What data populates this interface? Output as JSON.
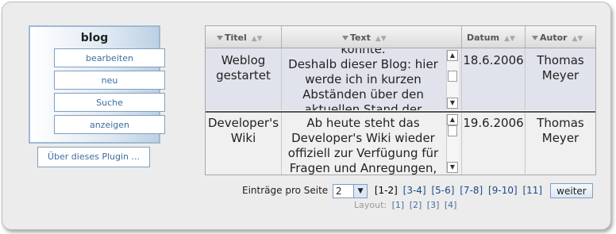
{
  "menu": {
    "title": "blog",
    "items": [
      "bearbeiten",
      "neu",
      "Suche",
      "anzeigen"
    ],
    "plugin_label": "Über dieses Plugin ..."
  },
  "table": {
    "columns": [
      "Titel",
      "Text",
      "Datum",
      "Autor"
    ],
    "rows": [
      {
        "title_lines": [
          "Weblog",
          "gestartet"
        ],
        "text_lines": [
          "konnte.",
          "Deshalb dieser Blog: hier",
          "werde ich in kurzen",
          "Abständen über den",
          "aktuellen Stand der"
        ],
        "date": "18.6.2006",
        "author_lines": [
          "Thomas",
          "Meyer"
        ]
      },
      {
        "title_lines": [
          "Developer's",
          "Wiki"
        ],
        "text_lines": [
          "Ab heute steht das",
          "Developer's Wiki wieder",
          "offiziell zur Verfügung für",
          "Fragen und Anregungen,"
        ],
        "date": "19.6.2006",
        "author_lines": [
          "Thomas",
          "Meyer"
        ]
      }
    ]
  },
  "pager": {
    "label": "Einträge pro Seite",
    "per_page": "2",
    "pages": [
      "[1-2]",
      "[3-4]",
      "[5-6]",
      "[7-8]",
      "[9-10]",
      "[11]"
    ],
    "next_label": "weiter",
    "layout_label": "Layout:",
    "layouts": [
      "[1]",
      "[2]",
      "[3]",
      "[4]"
    ]
  },
  "icons": {
    "filter": "funnel-icon",
    "sort": "sort-arrows-icon",
    "scroll_up": "arrow-up-icon",
    "scroll_down": "arrow-down-icon",
    "dropdown": "chevron-down-icon"
  }
}
